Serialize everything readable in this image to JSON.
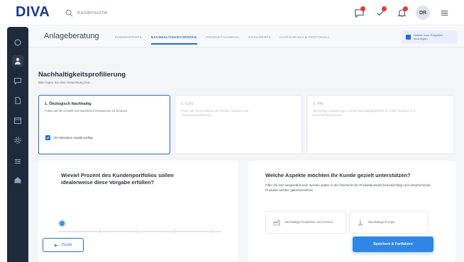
{
  "header": {
    "logo": "DIVA",
    "search_placeholder": "Kundensuche",
    "avatar_initials": "DR"
  },
  "subheader": {
    "title": "Anlageberatung",
    "tabs": [
      {
        "label": "Kundenprofil",
        "active": false
      },
      {
        "label": "Nachhaltigkeitsprofil",
        "active": true
      },
      {
        "label": "Produktauswahl",
        "active": false
      },
      {
        "label": "Dokumente",
        "active": false
      },
      {
        "label": "Ausführung & Protokoll",
        "active": false
      }
    ],
    "note": "Notizen zum Gespräch hinzufügen"
  },
  "section": {
    "title": "Nachhaltigkeitsprofilierung",
    "subtitle": "Bitte legen Sie eine Gewichtung fest."
  },
  "options": [
    {
      "title": "1. Ökologisch Nachhaltig",
      "desc": "Fokus auf die Umwelt und natürlichen Ressourcen zu schonen.",
      "checkbox_label": "Als relevanten Aspekt wichtig",
      "selected": true
    },
    {
      "title": "2. ESG",
      "desc": "Fokus auf die Einhaltung der Umwelt, Sozialen und Unternehmensführung.",
      "selected": false
    },
    {
      "title": "3. PAI",
      "desc": "Nachteilige Auswirkungen auf die Nachhaltigkeitsfaktoren sollen reduziert und berücksichtigt werden.",
      "selected": false
    }
  ],
  "left_panel": {
    "question": "Wieviel Prozent des Kundenportfolios sollen idealerweise diese Vorgabe erfüllen?"
  },
  "right_panel": {
    "question": "Welche Aspekte möchten Ihr Kunde gezielt unterstützen?",
    "text": "Filter die hier ausgewählt sind, werden später in der Übersicht der Produktauswahl berücksichtigt und entsprechende Produkte werden gekennzeichnet.",
    "aspects": [
      {
        "label": "Nachhaltige Produktion und Konsum",
        "icon": "factory-icon"
      },
      {
        "label": "Nachhaltige Energie",
        "icon": "energy-icon"
      }
    ]
  },
  "footer": {
    "back_label": "Zurück",
    "next_label": "Speichern & Fortfahren"
  },
  "colors": {
    "accent": "#1f6fd0",
    "sidebar": "#1e2a3a",
    "notification": "#e53935"
  }
}
